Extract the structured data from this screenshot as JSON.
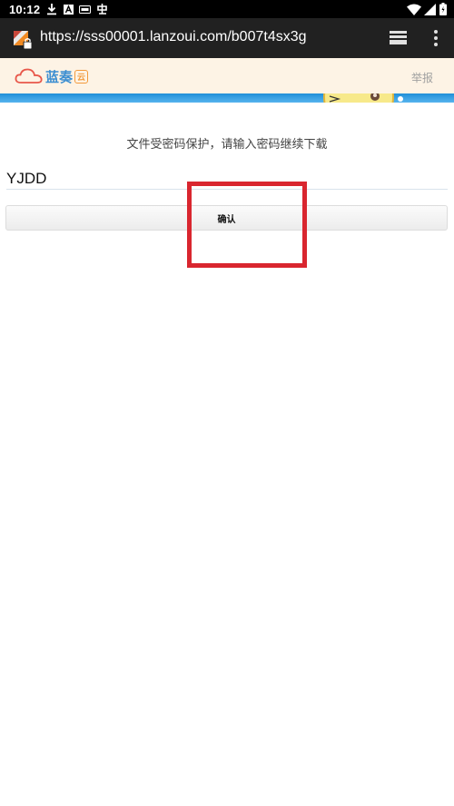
{
  "status_bar": {
    "time": "10:12",
    "left_icons": [
      "download-icon",
      "notification-a-icon",
      "sim-card-icon",
      "app-notification-icon"
    ],
    "right_icons": [
      "wifi-icon",
      "cell-signal-icon",
      "battery-icon"
    ]
  },
  "browser": {
    "url": "https://sss00001.lanzoui.com/b007t4sx3g",
    "site_icon": "site-security-icon",
    "tabs_icon": "tabs-icon",
    "menu_icon": "more-vert-icon"
  },
  "site": {
    "logo_text": "蓝奏",
    "logo_badge": "云",
    "report_link": "举报",
    "brand_color": "#3d8fd1",
    "accent_color": "#f39a3c"
  },
  "content": {
    "prompt": "文件受密码保护，请输入密码继续下载",
    "password_value": "YJDD",
    "confirm_label": "确认"
  },
  "annotation": {
    "highlight_color": "#d9262f"
  }
}
